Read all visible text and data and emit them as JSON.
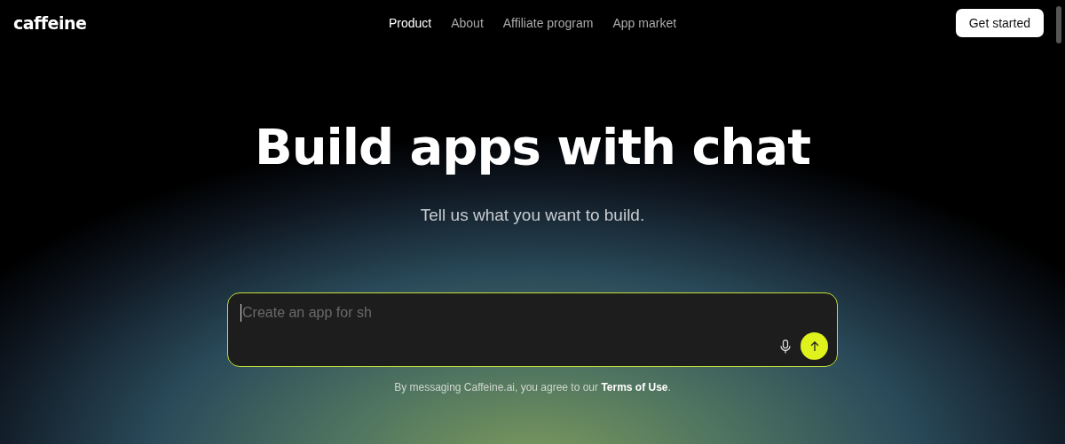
{
  "header": {
    "logo": "caffeine",
    "nav": [
      {
        "label": "Product",
        "selected": true
      },
      {
        "label": "About",
        "selected": false
      },
      {
        "label": "Affiliate program",
        "selected": false
      },
      {
        "label": "App market",
        "selected": false
      }
    ],
    "cta": "Get started"
  },
  "hero": {
    "title": "Build apps with chat",
    "subtitle": "Tell us what you want to build."
  },
  "prompt": {
    "placeholder": "Create an app for sh"
  },
  "notice": {
    "text": "By messaging Caffeine.ai, you agree to our ",
    "link": "Terms of Use",
    "end": "."
  }
}
